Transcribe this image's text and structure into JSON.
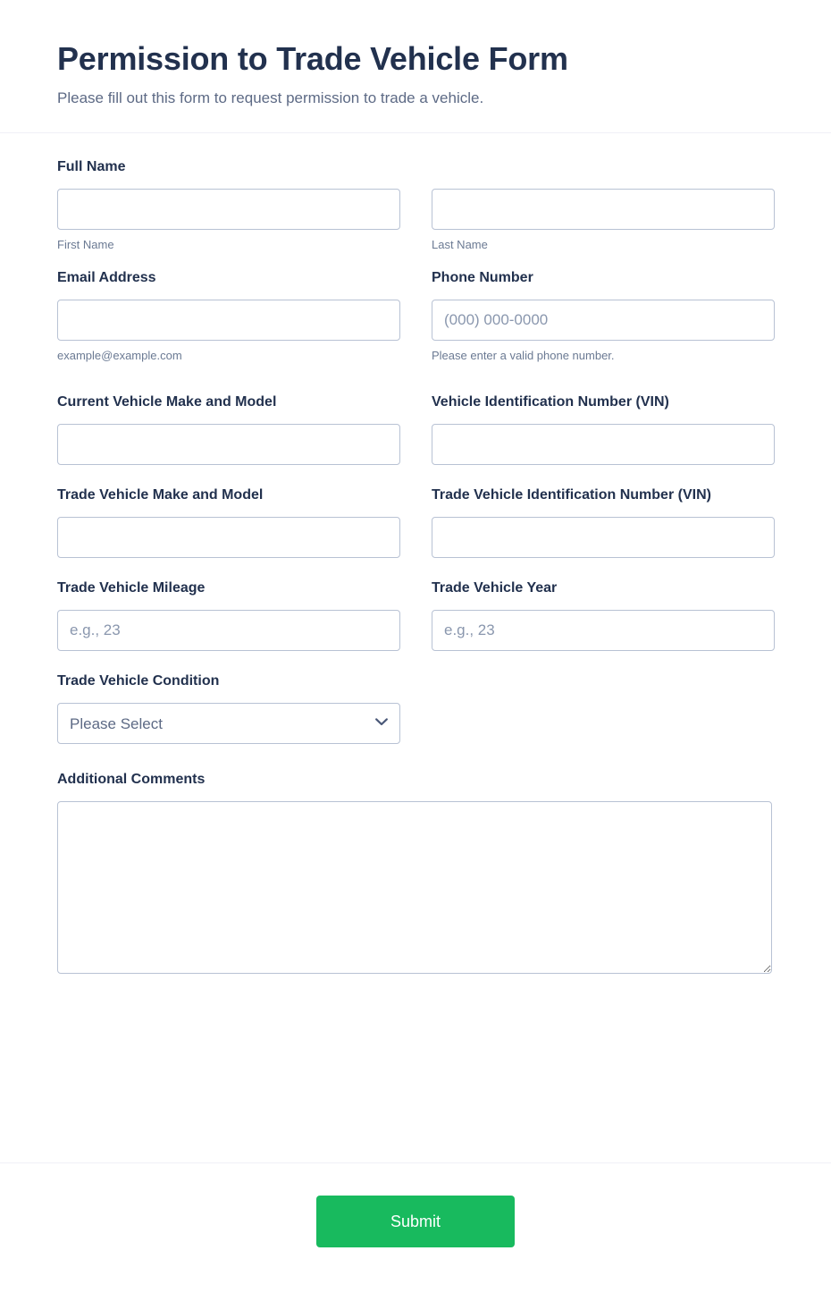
{
  "header": {
    "title": "Permission to Trade Vehicle Form",
    "subtitle": "Please fill out this form to request permission to trade a vehicle."
  },
  "fields": {
    "full_name": {
      "label": "Full Name",
      "first": {
        "value": "",
        "placeholder": "",
        "sub_label": "First Name"
      },
      "last": {
        "value": "",
        "placeholder": "",
        "sub_label": "Last Name"
      }
    },
    "email": {
      "label": "Email Address",
      "value": "",
      "placeholder": "",
      "sub_label": "example@example.com"
    },
    "phone": {
      "label": "Phone Number",
      "value": "",
      "placeholder": "(000) 000-0000",
      "sub_label": "Please enter a valid phone number."
    },
    "current_vehicle": {
      "label": "Current Vehicle Make and Model",
      "value": "",
      "placeholder": ""
    },
    "current_vin": {
      "label": "Vehicle Identification Number (VIN)",
      "value": "",
      "placeholder": ""
    },
    "trade_vehicle": {
      "label": "Trade Vehicle Make and Model",
      "value": "",
      "placeholder": ""
    },
    "trade_vin": {
      "label": "Trade Vehicle Identification Number (VIN)",
      "value": "",
      "placeholder": ""
    },
    "trade_mileage": {
      "label": "Trade Vehicle Mileage",
      "value": "",
      "placeholder": "e.g., 23"
    },
    "trade_year": {
      "label": "Trade Vehicle Year",
      "value": "",
      "placeholder": "e.g., 23"
    },
    "trade_condition": {
      "label": "Trade Vehicle Condition",
      "selected": "Please Select",
      "icon": "chevron-down-icon"
    },
    "comments": {
      "label": "Additional Comments",
      "value": "",
      "placeholder": ""
    }
  },
  "footer": {
    "submit_label": "Submit"
  },
  "colors": {
    "heading": "#22314e",
    "muted_text": "#5d6a85",
    "input_border": "#b8c2d4",
    "submit_green": "#18ba5e",
    "divider": "#f0f0f7"
  }
}
